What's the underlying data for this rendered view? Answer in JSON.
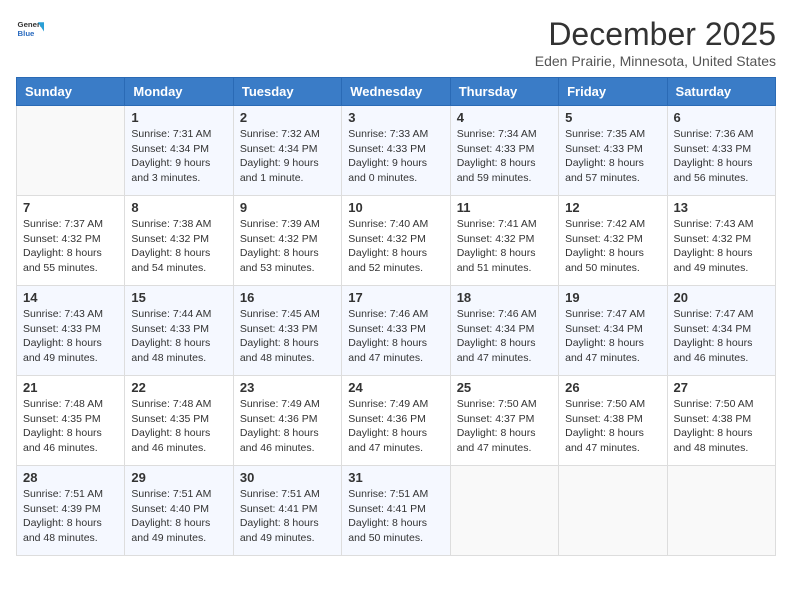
{
  "header": {
    "logo_general": "General",
    "logo_blue": "Blue",
    "month_title": "December 2025",
    "subtitle": "Eden Prairie, Minnesota, United States"
  },
  "days_of_week": [
    "Sunday",
    "Monday",
    "Tuesday",
    "Wednesday",
    "Thursday",
    "Friday",
    "Saturday"
  ],
  "weeks": [
    [
      {
        "day": "",
        "info": ""
      },
      {
        "day": "1",
        "info": "Sunrise: 7:31 AM\nSunset: 4:34 PM\nDaylight: 9 hours\nand 3 minutes."
      },
      {
        "day": "2",
        "info": "Sunrise: 7:32 AM\nSunset: 4:34 PM\nDaylight: 9 hours\nand 1 minute."
      },
      {
        "day": "3",
        "info": "Sunrise: 7:33 AM\nSunset: 4:33 PM\nDaylight: 9 hours\nand 0 minutes."
      },
      {
        "day": "4",
        "info": "Sunrise: 7:34 AM\nSunset: 4:33 PM\nDaylight: 8 hours\nand 59 minutes."
      },
      {
        "day": "5",
        "info": "Sunrise: 7:35 AM\nSunset: 4:33 PM\nDaylight: 8 hours\nand 57 minutes."
      },
      {
        "day": "6",
        "info": "Sunrise: 7:36 AM\nSunset: 4:33 PM\nDaylight: 8 hours\nand 56 minutes."
      }
    ],
    [
      {
        "day": "7",
        "info": "Sunrise: 7:37 AM\nSunset: 4:32 PM\nDaylight: 8 hours\nand 55 minutes."
      },
      {
        "day": "8",
        "info": "Sunrise: 7:38 AM\nSunset: 4:32 PM\nDaylight: 8 hours\nand 54 minutes."
      },
      {
        "day": "9",
        "info": "Sunrise: 7:39 AM\nSunset: 4:32 PM\nDaylight: 8 hours\nand 53 minutes."
      },
      {
        "day": "10",
        "info": "Sunrise: 7:40 AM\nSunset: 4:32 PM\nDaylight: 8 hours\nand 52 minutes."
      },
      {
        "day": "11",
        "info": "Sunrise: 7:41 AM\nSunset: 4:32 PM\nDaylight: 8 hours\nand 51 minutes."
      },
      {
        "day": "12",
        "info": "Sunrise: 7:42 AM\nSunset: 4:32 PM\nDaylight: 8 hours\nand 50 minutes."
      },
      {
        "day": "13",
        "info": "Sunrise: 7:43 AM\nSunset: 4:32 PM\nDaylight: 8 hours\nand 49 minutes."
      }
    ],
    [
      {
        "day": "14",
        "info": "Sunrise: 7:43 AM\nSunset: 4:33 PM\nDaylight: 8 hours\nand 49 minutes."
      },
      {
        "day": "15",
        "info": "Sunrise: 7:44 AM\nSunset: 4:33 PM\nDaylight: 8 hours\nand 48 minutes."
      },
      {
        "day": "16",
        "info": "Sunrise: 7:45 AM\nSunset: 4:33 PM\nDaylight: 8 hours\nand 48 minutes."
      },
      {
        "day": "17",
        "info": "Sunrise: 7:46 AM\nSunset: 4:33 PM\nDaylight: 8 hours\nand 47 minutes."
      },
      {
        "day": "18",
        "info": "Sunrise: 7:46 AM\nSunset: 4:34 PM\nDaylight: 8 hours\nand 47 minutes."
      },
      {
        "day": "19",
        "info": "Sunrise: 7:47 AM\nSunset: 4:34 PM\nDaylight: 8 hours\nand 47 minutes."
      },
      {
        "day": "20",
        "info": "Sunrise: 7:47 AM\nSunset: 4:34 PM\nDaylight: 8 hours\nand 46 minutes."
      }
    ],
    [
      {
        "day": "21",
        "info": "Sunrise: 7:48 AM\nSunset: 4:35 PM\nDaylight: 8 hours\nand 46 minutes."
      },
      {
        "day": "22",
        "info": "Sunrise: 7:48 AM\nSunset: 4:35 PM\nDaylight: 8 hours\nand 46 minutes."
      },
      {
        "day": "23",
        "info": "Sunrise: 7:49 AM\nSunset: 4:36 PM\nDaylight: 8 hours\nand 46 minutes."
      },
      {
        "day": "24",
        "info": "Sunrise: 7:49 AM\nSunset: 4:36 PM\nDaylight: 8 hours\nand 47 minutes."
      },
      {
        "day": "25",
        "info": "Sunrise: 7:50 AM\nSunset: 4:37 PM\nDaylight: 8 hours\nand 47 minutes."
      },
      {
        "day": "26",
        "info": "Sunrise: 7:50 AM\nSunset: 4:38 PM\nDaylight: 8 hours\nand 47 minutes."
      },
      {
        "day": "27",
        "info": "Sunrise: 7:50 AM\nSunset: 4:38 PM\nDaylight: 8 hours\nand 48 minutes."
      }
    ],
    [
      {
        "day": "28",
        "info": "Sunrise: 7:51 AM\nSunset: 4:39 PM\nDaylight: 8 hours\nand 48 minutes."
      },
      {
        "day": "29",
        "info": "Sunrise: 7:51 AM\nSunset: 4:40 PM\nDaylight: 8 hours\nand 49 minutes."
      },
      {
        "day": "30",
        "info": "Sunrise: 7:51 AM\nSunset: 4:41 PM\nDaylight: 8 hours\nand 49 minutes."
      },
      {
        "day": "31",
        "info": "Sunrise: 7:51 AM\nSunset: 4:41 PM\nDaylight: 8 hours\nand 50 minutes."
      },
      {
        "day": "",
        "info": ""
      },
      {
        "day": "",
        "info": ""
      },
      {
        "day": "",
        "info": ""
      }
    ]
  ]
}
